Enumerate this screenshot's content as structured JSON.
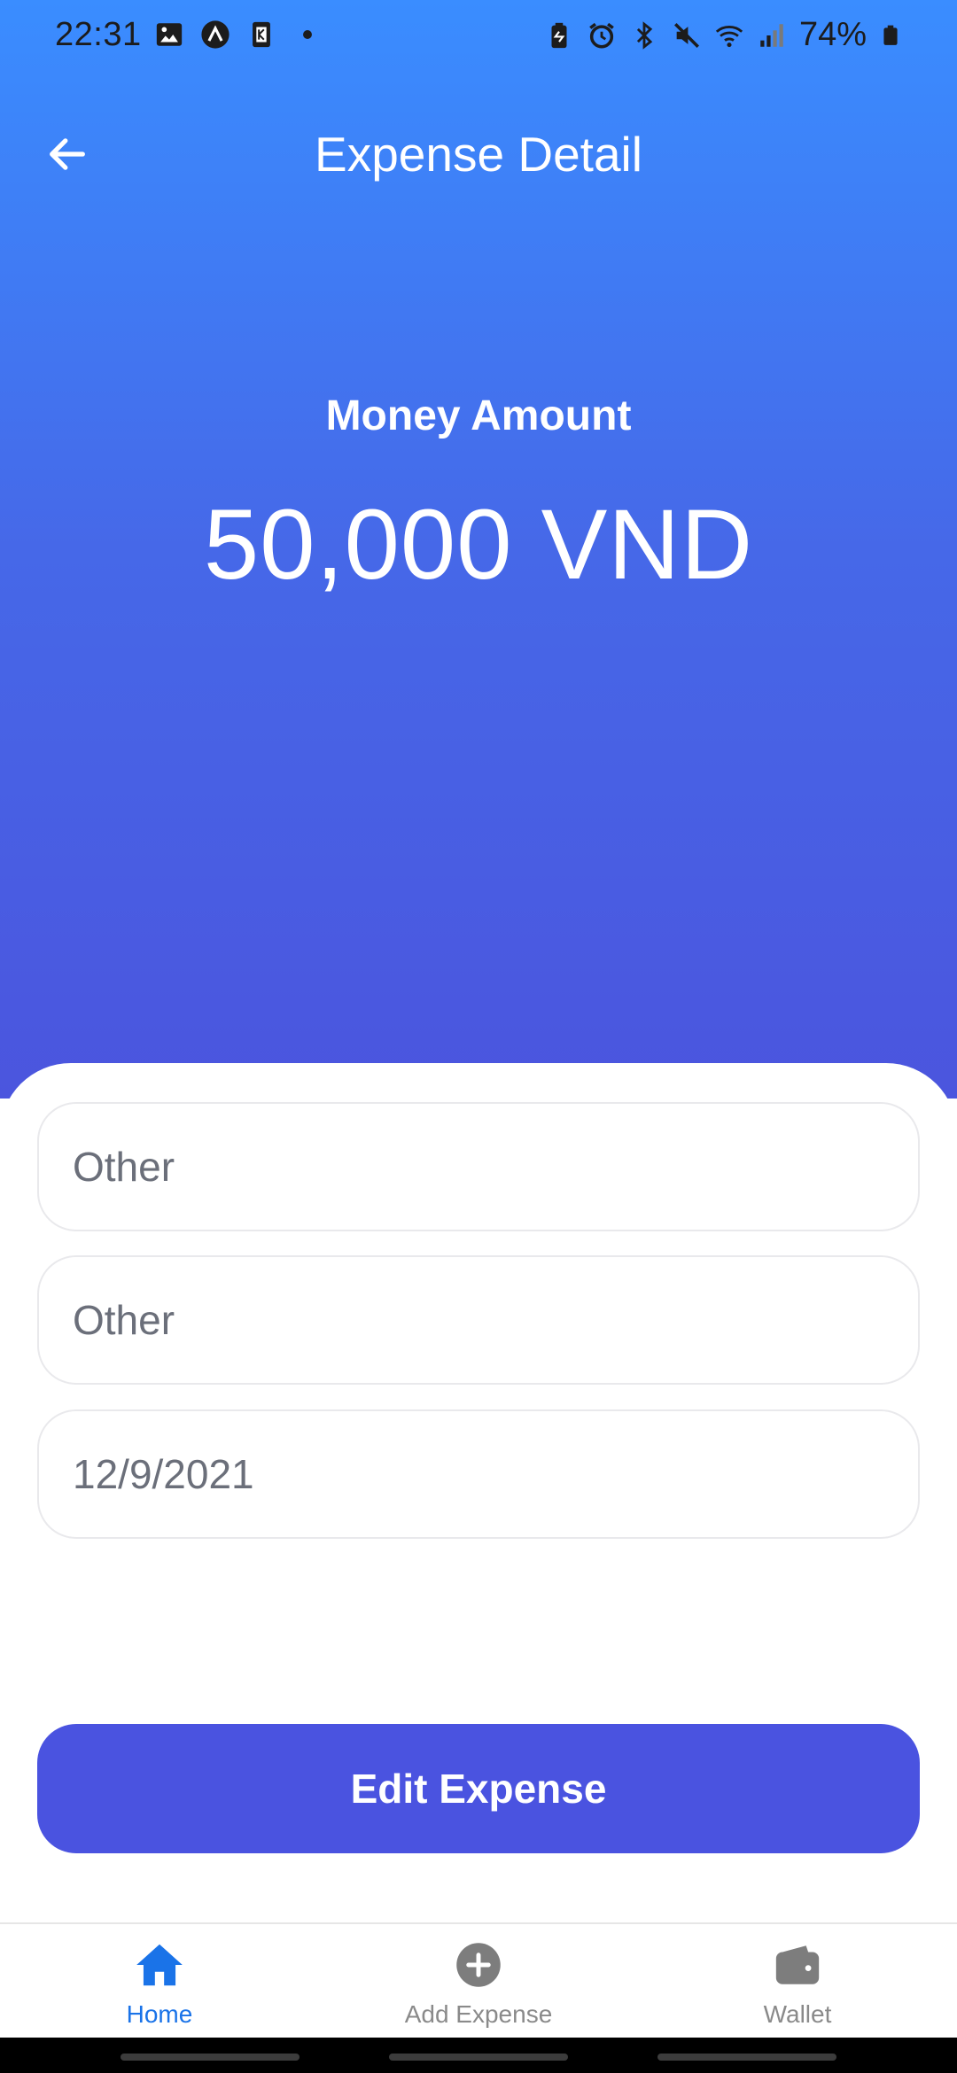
{
  "status_bar": {
    "time": "22:31",
    "battery": "74%",
    "left_icons": [
      "gallery-icon",
      "app-a-icon",
      "app-k-icon",
      "dot-icon"
    ],
    "right_icons": [
      "battery-saver-icon",
      "alarm-icon",
      "bluetooth-icon",
      "mute-icon",
      "wifi-icon",
      "signal-icon",
      "battery-icon"
    ]
  },
  "header": {
    "title": "Expense Detail",
    "back_icon": "back-arrow-icon"
  },
  "amount": {
    "label": "Money Amount",
    "value": "50,000 VND"
  },
  "form": {
    "category": "Other",
    "note": "Other",
    "date": "12/9/2021"
  },
  "actions": {
    "edit_label": "Edit Expense"
  },
  "bottom_nav": {
    "items": [
      {
        "label": "Home",
        "icon": "home-icon",
        "active": true
      },
      {
        "label": "Add Expense",
        "icon": "add-circle-icon",
        "active": false
      },
      {
        "label": "Wallet",
        "icon": "wallet-icon",
        "active": false
      }
    ]
  },
  "colors": {
    "gradient_top": "#3a8dff",
    "gradient_bottom": "#4b55de",
    "primary_button": "#4a53e0",
    "active_tab": "#1a73e8",
    "inactive_tab": "#8a8a8a"
  }
}
